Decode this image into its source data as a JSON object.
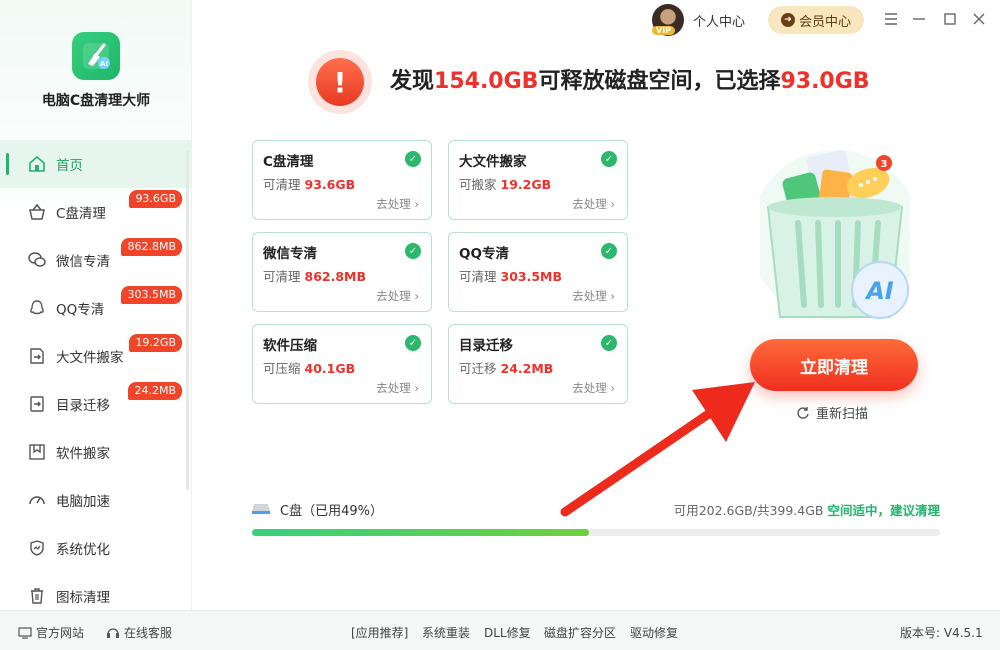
{
  "app": {
    "name": "电脑C盘清理大师"
  },
  "topbar": {
    "personal_label": "个人中心",
    "member_label": "会员中心",
    "vip_badge": "VIP"
  },
  "sidebar": {
    "items": [
      {
        "label": "首页",
        "badge": "",
        "icon": "home-icon"
      },
      {
        "label": "C盘清理",
        "badge": "93.6GB",
        "icon": "basket-icon"
      },
      {
        "label": "微信专清",
        "badge": "862.8MB",
        "icon": "wechat-icon"
      },
      {
        "label": "QQ专清",
        "badge": "303.5MB",
        "icon": "qq-icon"
      },
      {
        "label": "大文件搬家",
        "badge": "19.2GB",
        "icon": "file-move-icon"
      },
      {
        "label": "目录迁移",
        "badge": "24.2MB",
        "icon": "folder-move-icon"
      },
      {
        "label": "软件搬家",
        "badge": "",
        "icon": "software-icon"
      },
      {
        "label": "电脑加速",
        "badge": "",
        "icon": "speedometer-icon"
      },
      {
        "label": "系统优化",
        "badge": "",
        "icon": "shield-icon"
      },
      {
        "label": "图标清理",
        "badge": "",
        "icon": "trash-icon"
      }
    ]
  },
  "headline": {
    "prefix": "发现",
    "found": "154.0GB",
    "middle": "可释放磁盘空间，已选择",
    "selected": "93.0GB"
  },
  "cards": [
    {
      "title": "C盘清理",
      "line_label": "可清理",
      "value": "93.6GB",
      "action": "去处理 ›"
    },
    {
      "title": "大文件搬家",
      "line_label": "可搬家",
      "value": "19.2GB",
      "action": "去处理 ›"
    },
    {
      "title": "微信专清",
      "line_label": "可清理",
      "value": "862.8MB",
      "action": "去处理 ›"
    },
    {
      "title": "QQ专清",
      "line_label": "可清理",
      "value": "303.5MB",
      "action": "去处理 ›"
    },
    {
      "title": "软件压缩",
      "line_label": "可压缩",
      "value": "40.1GB",
      "action": "去处理 ›"
    },
    {
      "title": "目录迁移",
      "line_label": "可迁移",
      "value": "24.2MB",
      "action": "去处理 ›"
    }
  ],
  "actions": {
    "clean_now": "立即清理",
    "rescan": "重新扫描"
  },
  "bin_badge": "3",
  "bin_ai": "AI",
  "logo_ai": "AI",
  "disk": {
    "label": "C盘（已用49%）",
    "used_fraction": 0.49,
    "capacity": "可用202.6GB/共399.4GB",
    "status": "空间适中，建议清理"
  },
  "footer": {
    "official_site": "官方网站",
    "online_service": "在线客服",
    "links": [
      "[应用推荐]",
      "系统重装",
      "DLL修复",
      "磁盘扩容分区",
      "驱动修复"
    ],
    "version": "版本号:   V4.5.1"
  },
  "colors": {
    "accent_green": "#1fb56a",
    "accent_red": "#f0302a"
  }
}
